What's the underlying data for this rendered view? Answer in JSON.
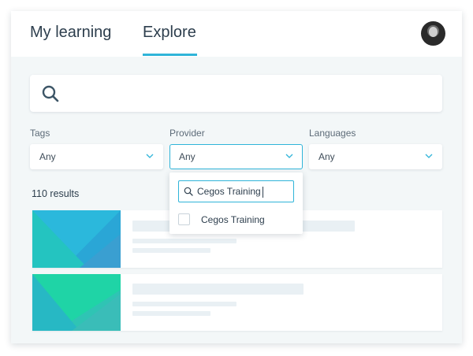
{
  "tabs": {
    "my_learning": "My learning",
    "explore": "Explore",
    "active": "explore"
  },
  "search": {
    "placeholder": "",
    "icon": "search-icon"
  },
  "filters": {
    "tags": {
      "label": "Tags",
      "value": "Any"
    },
    "provider": {
      "label": "Provider",
      "value": "Any"
    },
    "languages": {
      "label": "Languages",
      "value": "Any"
    }
  },
  "provider_dropdown": {
    "search_value": "Cegos Training",
    "options": [
      {
        "label": "Cegos Training",
        "checked": false
      }
    ]
  },
  "results": {
    "count_text": "110 results"
  },
  "colors": {
    "accent": "#2fb4d9",
    "text": "#2d3e4d",
    "background": "#f3f7f8",
    "placeholder_bar": "#e9f0f4"
  }
}
